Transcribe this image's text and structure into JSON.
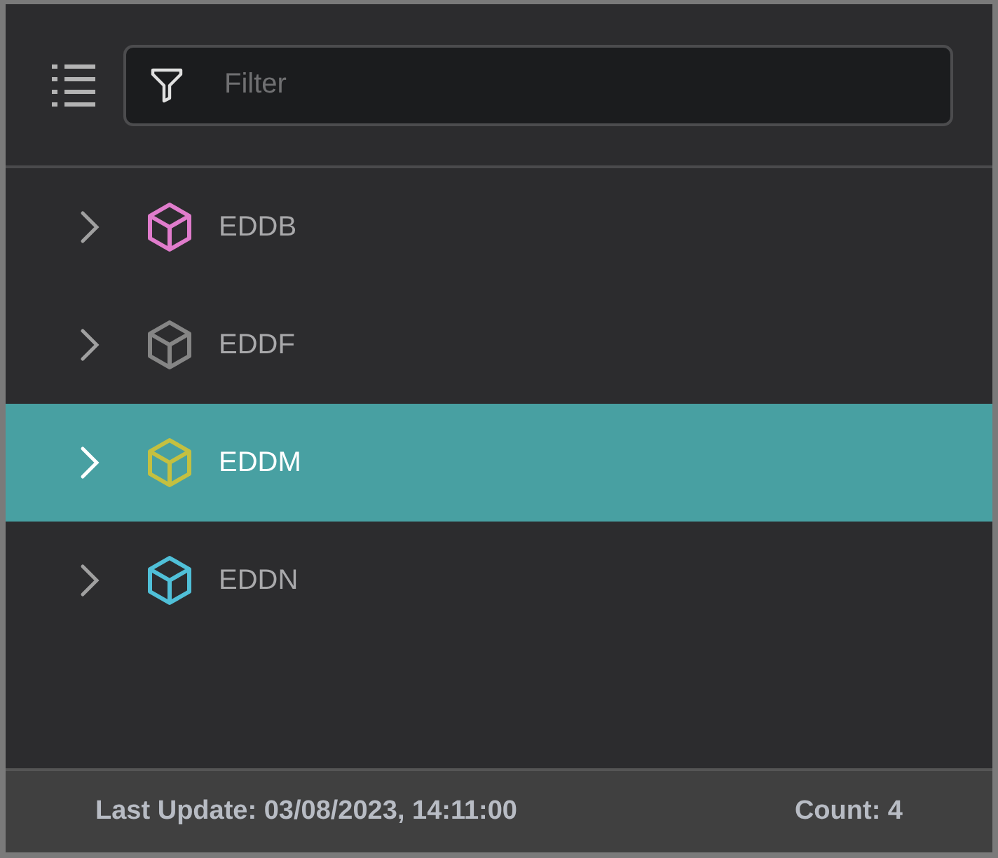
{
  "filter": {
    "placeholder": "Filter"
  },
  "items": [
    {
      "label": "EDDB",
      "color": "#e07ccc",
      "selected": false
    },
    {
      "label": "EDDF",
      "color": "#858585",
      "selected": false
    },
    {
      "label": "EDDM",
      "color": "#c4c040",
      "selected": true
    },
    {
      "label": "EDDN",
      "color": "#50c0d8",
      "selected": false
    }
  ],
  "status_bar": {
    "last_update": "Last Update: 03/08/2023, 14:11:00",
    "count": "Count: 4"
  }
}
